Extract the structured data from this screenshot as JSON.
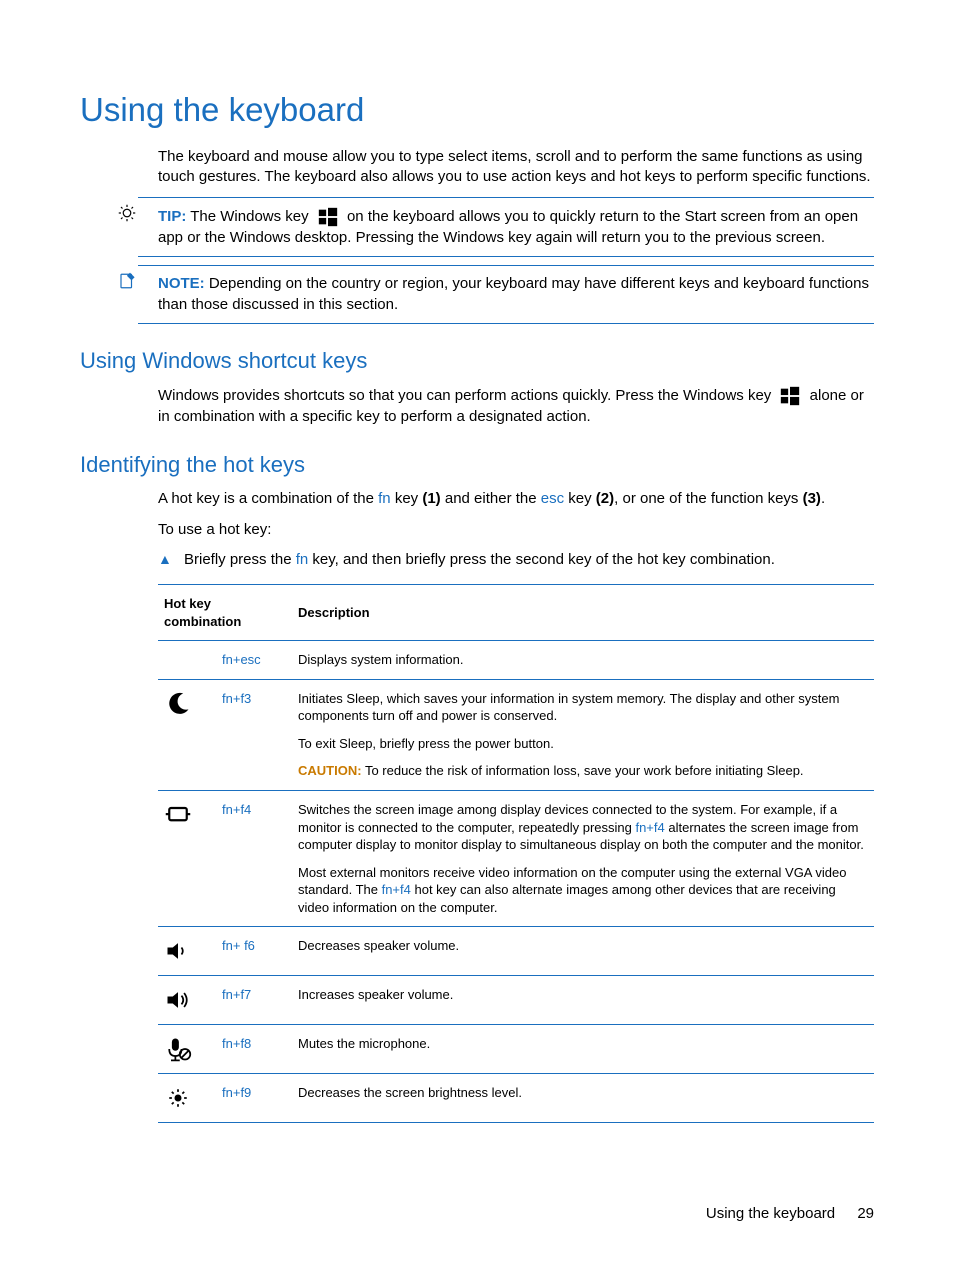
{
  "title": "Using the keyboard",
  "intro": "The keyboard and mouse allow you to type select items, scroll and to perform the same functions as using touch gestures. The keyboard also allows you to use action keys and hot keys to perform specific functions.",
  "tip": {
    "label": "TIP:",
    "before_icon": "The Windows key",
    "after_icon": "on the keyboard allows you to quickly return to the Start screen from an open app or the Windows desktop. Pressing the Windows key again will return you to the previous screen."
  },
  "note": {
    "label": "NOTE:",
    "text": "Depending on the country or region, your keyboard may have different keys and keyboard functions than those discussed in this section."
  },
  "sections": {
    "shortcuts_title": "Using Windows shortcut keys",
    "shortcuts_before_icon": "Windows provides shortcuts so that you can perform actions quickly. Press the Windows key",
    "shortcuts_after_icon": "alone or in combination with a specific key to perform a designated action.",
    "hotkeys_title": "Identifying the hot keys",
    "hotkeys_intro_parts": {
      "p1_a": "A hot key is a combination of the ",
      "fn": "fn",
      "p1_b": " key ",
      "b1": "(1)",
      "p1_c": " and either the ",
      "esc": "esc",
      "p1_d": " key ",
      "b2": "(2)",
      "p1_e": ", or one of the function keys ",
      "b3": "(3)",
      "p1_f": "."
    },
    "hotkeys_intro2": "To use a hot key:",
    "bullet_parts": {
      "a": "Briefly press the ",
      "fn": "fn",
      "b": " key, and then briefly press the second key of the hot key combination."
    }
  },
  "table": {
    "headers": {
      "combo": "Hot key combination",
      "desc": "Description"
    },
    "rows": [
      {
        "icon": "none",
        "combo_parts": [
          "fn",
          "+",
          "esc"
        ],
        "desc_paras": [
          {
            "plain": "Displays system information."
          }
        ]
      },
      {
        "icon": "sleep",
        "combo_parts": [
          "fn",
          "+",
          "f3"
        ],
        "desc_paras": [
          {
            "plain": "Initiates Sleep, which saves your information in system memory. The display and other system components turn off and power is conserved."
          },
          {
            "plain": "To exit Sleep, briefly press the power button."
          },
          {
            "caution_label": "CAUTION:",
            "caution_text": "To reduce the risk of information loss, save your work before initiating Sleep."
          }
        ]
      },
      {
        "icon": "display",
        "combo_parts": [
          "fn",
          "+",
          "f4"
        ],
        "desc_paras": [
          {
            "mixed_pre": "Switches the screen image among display devices connected to the system. For example, if a monitor is connected to the computer, repeatedly pressing ",
            "mixed_key": "fn+f4",
            "mixed_post": " alternates the screen image from computer display to monitor display to simultaneous display on both the computer and the monitor."
          },
          {
            "mixed_pre": "Most external monitors receive video information on the computer using the external VGA video standard. The ",
            "mixed_key": "fn+f4",
            "mixed_post": " hot key can also alternate images among other devices that are receiving video information on the computer."
          }
        ]
      },
      {
        "icon": "vol-down",
        "combo_parts": [
          "fn",
          "+ ",
          "f6"
        ],
        "desc_paras": [
          {
            "plain": "Decreases speaker volume."
          }
        ]
      },
      {
        "icon": "vol-up",
        "combo_parts": [
          "fn",
          "+",
          "f7"
        ],
        "desc_paras": [
          {
            "plain": "Increases speaker volume."
          }
        ]
      },
      {
        "icon": "mic-mute",
        "combo_parts": [
          "fn",
          "+",
          "f8"
        ],
        "desc_paras": [
          {
            "plain": "Mutes the microphone."
          }
        ]
      },
      {
        "icon": "bright-down",
        "combo_parts": [
          "fn",
          "+",
          "f9"
        ],
        "desc_paras": [
          {
            "plain": "Decreases the screen brightness level."
          }
        ]
      }
    ]
  },
  "footer": {
    "text": "Using the keyboard",
    "page": "29"
  }
}
